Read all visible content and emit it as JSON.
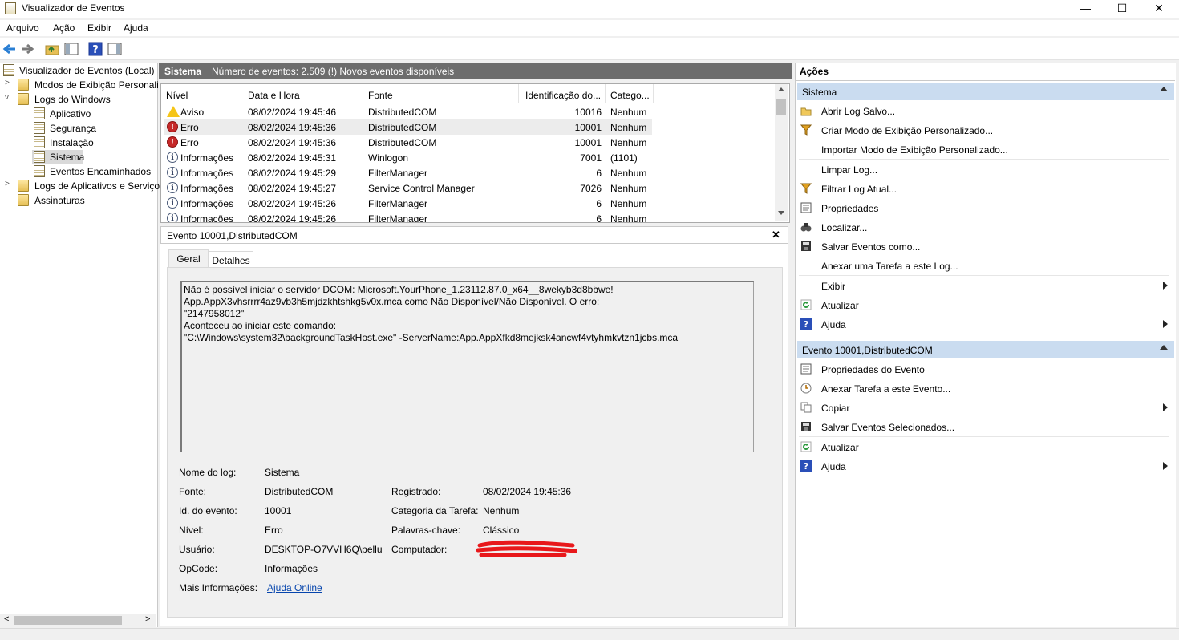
{
  "window": {
    "title": "Visualizador de Eventos",
    "minimize": "—",
    "maximize": "☐",
    "close": "✕"
  },
  "menu": [
    "Arquivo",
    "Ação",
    "Exibir",
    "Ajuda"
  ],
  "tree": {
    "root": "Visualizador de Eventos (Local)",
    "items": [
      {
        "label": "Modos de Exibição Personali"
      },
      {
        "label": "Logs do Windows"
      },
      {
        "label": "Aplicativo"
      },
      {
        "label": "Segurança"
      },
      {
        "label": "Instalação"
      },
      {
        "label": "Sistema"
      },
      {
        "label": "Eventos Encaminhados"
      },
      {
        "label": "Logs de Aplicativos e Serviço"
      },
      {
        "label": "Assinaturas"
      }
    ]
  },
  "middle": {
    "log_name": "Sistema",
    "summary": "Número de eventos: 2.509 (!) Novos eventos disponíveis",
    "columns": [
      "Nível",
      "Data e Hora",
      "Fonte",
      "Identificação do...",
      "Catego..."
    ],
    "rows": [
      {
        "level": "Aviso",
        "severity": "warning",
        "datetime": "08/02/2024 19:45:46",
        "source": "DistributedCOM",
        "id": "10016",
        "category": "Nenhum"
      },
      {
        "level": "Erro",
        "severity": "error",
        "datetime": "08/02/2024 19:45:36",
        "source": "DistributedCOM",
        "id": "10001",
        "category": "Nenhum"
      },
      {
        "level": "Erro",
        "severity": "error",
        "datetime": "08/02/2024 19:45:36",
        "source": "DistributedCOM",
        "id": "10001",
        "category": "Nenhum"
      },
      {
        "level": "Informações",
        "severity": "info",
        "datetime": "08/02/2024 19:45:31",
        "source": "Winlogon",
        "id": "7001",
        "category": "(1101)"
      },
      {
        "level": "Informações",
        "severity": "info",
        "datetime": "08/02/2024 19:45:29",
        "source": "FilterManager",
        "id": "6",
        "category": "Nenhum"
      },
      {
        "level": "Informações",
        "severity": "info",
        "datetime": "08/02/2024 19:45:27",
        "source": "Service Control Manager",
        "id": "7026",
        "category": "Nenhum"
      },
      {
        "level": "Informações",
        "severity": "info",
        "datetime": "08/02/2024 19:45:26",
        "source": "FilterManager",
        "id": "6",
        "category": "Nenhum"
      },
      {
        "level": "Informações",
        "severity": "info",
        "datetime": "08/02/2024 19:45:26",
        "source": "FilterManager",
        "id": "6",
        "category": "Nenhum"
      }
    ]
  },
  "detail": {
    "header": "Evento 10001,DistributedCOM",
    "close_glyph": "✕",
    "tabs": [
      "Geral",
      "Detalhes"
    ],
    "message_lines": [
      "Não é possível iniciar o servidor DCOM: Microsoft.YourPhone_1.23112.87.0_x64__8wekyb3d8bbwe!",
      "App.AppX3vhsrrrr4az9vb3h5mjdzkhtshkg5v0x.mca como Não Disponível/Não Disponível. O erro:",
      "\"2147958012\"",
      "Aconteceu ao iniciar este comando:",
      "\"C:\\Windows\\system32\\backgroundTaskHost.exe\" -ServerName:App.AppXfkd8mejksk4ancwf4vtyhmkvtzn1jcbs.mca"
    ],
    "props": {
      "log_name_label": "Nome do log:",
      "log_name_value": "Sistema",
      "source_label": "Fonte:",
      "source_value": "DistributedCOM",
      "logged_label": "Registrado:",
      "logged_value": "08/02/2024 19:45:36",
      "event_id_label": "Id. do evento:",
      "event_id_value": "10001",
      "task_label": "Categoria da Tarefa:",
      "task_value": "Nenhum",
      "level_label": "Nível:",
      "level_value": "Erro",
      "keywords_label": "Palavras-chave:",
      "keywords_value": "Clássico",
      "user_label": "Usuário:",
      "user_value": "DESKTOP-O7VVH6Q\\pellu",
      "computer_label": "Computador:",
      "opcode_label": "OpCode:",
      "opcode_value": "Informações",
      "moreinfo_label": "Mais Informações:",
      "moreinfo_link": "Ajuda Online"
    }
  },
  "actions": {
    "title": "Ações",
    "section1": {
      "title": "Sistema",
      "items": [
        {
          "label": "Abrir Log Salvo...",
          "icon": "folder-open-icon"
        },
        {
          "label": "Criar Modo de Exibição Personalizado...",
          "icon": "filter-icon"
        },
        {
          "label": "Importar Modo de Exibição Personalizado...",
          "icon": "none"
        },
        {
          "label": "Limpar Log...",
          "icon": "none"
        },
        {
          "label": "Filtrar Log Atual...",
          "icon": "filter-icon"
        },
        {
          "label": "Propriedades",
          "icon": "properties-icon"
        },
        {
          "label": "Localizar...",
          "icon": "binoculars-icon"
        },
        {
          "label": "Salvar Eventos como...",
          "icon": "save-icon"
        },
        {
          "label": "Anexar uma Tarefa a este Log...",
          "icon": "none"
        },
        {
          "label": "Exibir",
          "icon": "none",
          "submenu": true
        },
        {
          "label": "Atualizar",
          "icon": "refresh-icon"
        },
        {
          "label": "Ajuda",
          "icon": "help-icon",
          "submenu": true
        }
      ]
    },
    "section2": {
      "title": "Evento 10001,DistributedCOM",
      "items": [
        {
          "label": "Propriedades do Evento",
          "icon": "properties-icon"
        },
        {
          "label": "Anexar Tarefa a este Evento...",
          "icon": "clock-icon"
        },
        {
          "label": "Copiar",
          "icon": "copy-icon",
          "submenu": true
        },
        {
          "label": "Salvar Eventos Selecionados...",
          "icon": "save-icon"
        },
        {
          "label": "Atualizar",
          "icon": "refresh-icon"
        },
        {
          "label": "Ajuda",
          "icon": "help-icon",
          "submenu": true
        }
      ]
    }
  },
  "colors": {
    "accent_header": "#cadcf0",
    "pane_header": "#6d6d6d",
    "error": "#c62828",
    "warning": "#f5c518",
    "link": "#0645ad"
  }
}
